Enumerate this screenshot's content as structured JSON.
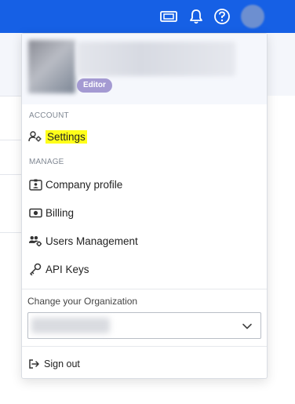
{
  "topbar": {
    "icons": [
      "ticket-icon",
      "bell-icon",
      "help-icon"
    ],
    "accent": "#1660e5"
  },
  "profile": {
    "role_badge": "Editor"
  },
  "sections": {
    "account": "ACCOUNT",
    "manage": "MANAGE"
  },
  "account_items": [
    {
      "label": "Settings",
      "icon": "user-gear-icon"
    }
  ],
  "manage_items": [
    {
      "label": "Company profile",
      "icon": "id-card-icon"
    },
    {
      "label": "Billing",
      "icon": "money-icon"
    },
    {
      "label": "Users Management",
      "icon": "users-gear-icon"
    },
    {
      "label": "API Keys",
      "icon": "key-icon"
    }
  ],
  "organization": {
    "label": "Change your Organization"
  },
  "signout": {
    "label": "Sign out"
  },
  "colors": {
    "highlight": "#ffff1a",
    "badge": "#a49ad2"
  }
}
